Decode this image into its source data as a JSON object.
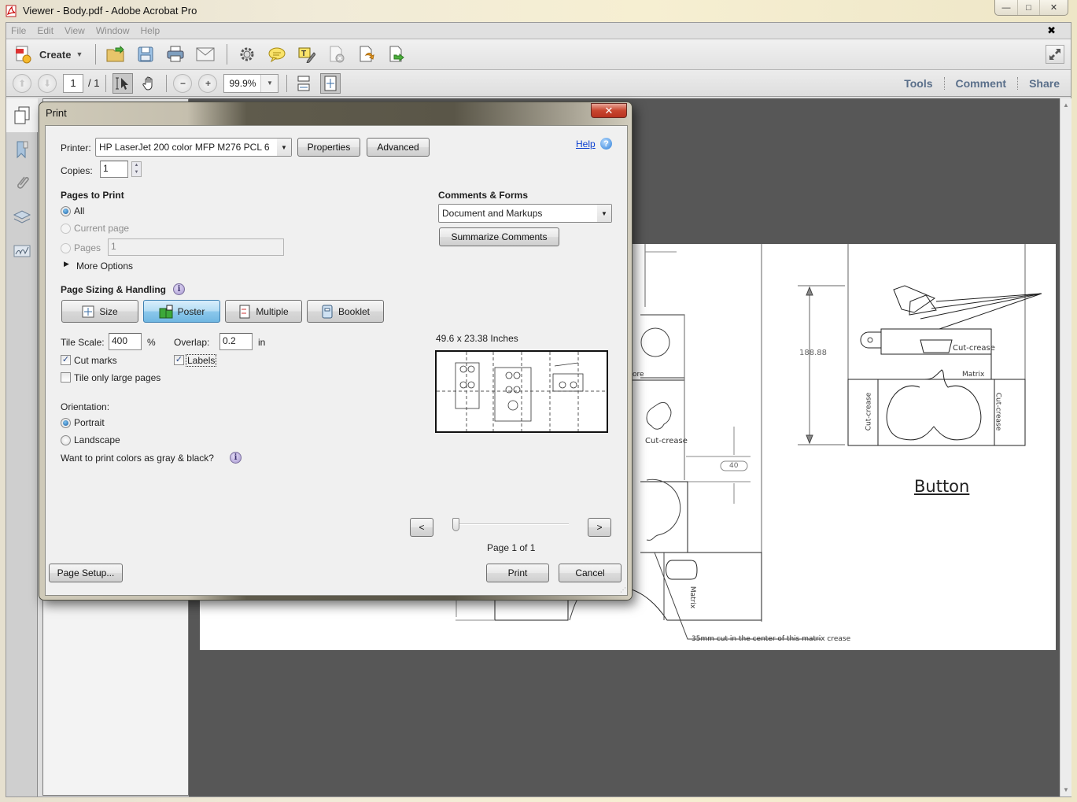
{
  "window": {
    "title": "Viewer - Body.pdf - Adobe Acrobat Pro",
    "controls": {
      "minimize": "—",
      "maximize": "□",
      "close": "✕"
    }
  },
  "menubar": {
    "items": [
      "File",
      "Edit",
      "View",
      "Window",
      "Help"
    ],
    "doc_close": "✖"
  },
  "toolbar": {
    "create_label": "Create",
    "icons": [
      "open-icon",
      "save-icon",
      "print-icon",
      "email-icon",
      "settings-icon",
      "comment-icon",
      "typewriter-icon",
      "delete-page-icon",
      "export-icon",
      "share-file-icon"
    ]
  },
  "navbar": {
    "page_current": "1",
    "page_total": "/ 1",
    "zoom": "99.9%",
    "right_links": [
      "Tools",
      "Comment",
      "Share"
    ]
  },
  "drawing": {
    "labels": {
      "dimension_height": "188.88",
      "dimension_40": "40",
      "cut_crease_1": "Cut-crease",
      "cut_crease_2": "Cut-crease",
      "cut_crease_left": "Cut-crease",
      "cut_crease_right": "Cut-crease",
      "matrix_1": "Matrix",
      "matrix_2": "Matrix",
      "partial_ore": "ore",
      "button_title": "Button",
      "note": "35mm cut in the center of this matrix crease"
    }
  },
  "print_dialog": {
    "title": "Print",
    "close": "✕",
    "printer_label": "Printer:",
    "printer_value": "HP LaserJet 200 color MFP M276 PCL 6",
    "properties_btn": "Properties",
    "advanced_btn": "Advanced",
    "help_link": "Help",
    "copies_label": "Copies:",
    "copies_value": "1",
    "pages_to_print": {
      "heading": "Pages to Print",
      "options": [
        {
          "label": "All",
          "selected": true,
          "enabled": true
        },
        {
          "label": "Current page",
          "selected": false,
          "enabled": false
        },
        {
          "label": "Pages",
          "selected": false,
          "enabled": false
        }
      ],
      "pages_value": "1",
      "more_options": "More Options"
    },
    "comments_forms": {
      "heading": "Comments & Forms",
      "value": "Document and Markups",
      "summarize_btn": "Summarize Comments"
    },
    "page_sizing": {
      "heading": "Page Sizing & Handling",
      "modes": [
        {
          "label": "Size",
          "active": false
        },
        {
          "label": "Poster",
          "active": true
        },
        {
          "label": "Multiple",
          "active": false
        },
        {
          "label": "Booklet",
          "active": false
        }
      ],
      "tile_scale_label": "Tile Scale:",
      "tile_scale_value": "400",
      "tile_scale_unit": "%",
      "overlap_label": "Overlap:",
      "overlap_value": "0.2",
      "overlap_unit": "in",
      "cut_marks_label": "Cut marks",
      "cut_marks_checked": true,
      "labels_label": "Labels",
      "labels_checked": true,
      "tile_large_label": "Tile only large pages",
      "tile_large_checked": false
    },
    "orientation": {
      "heading": "Orientation:",
      "options": [
        {
          "label": "Portrait",
          "selected": true
        },
        {
          "label": "Landscape",
          "selected": false
        }
      ]
    },
    "gray_question": "Want to print colors as gray & black?",
    "preview": {
      "size_text": "49.6 x 23.38 Inches",
      "prev_btn": "<",
      "next_btn": ">",
      "page_indicator": "Page 1 of 1",
      "slider_position": 0
    },
    "page_setup_btn": "Page Setup...",
    "print_btn": "Print",
    "cancel_btn": "Cancel"
  }
}
